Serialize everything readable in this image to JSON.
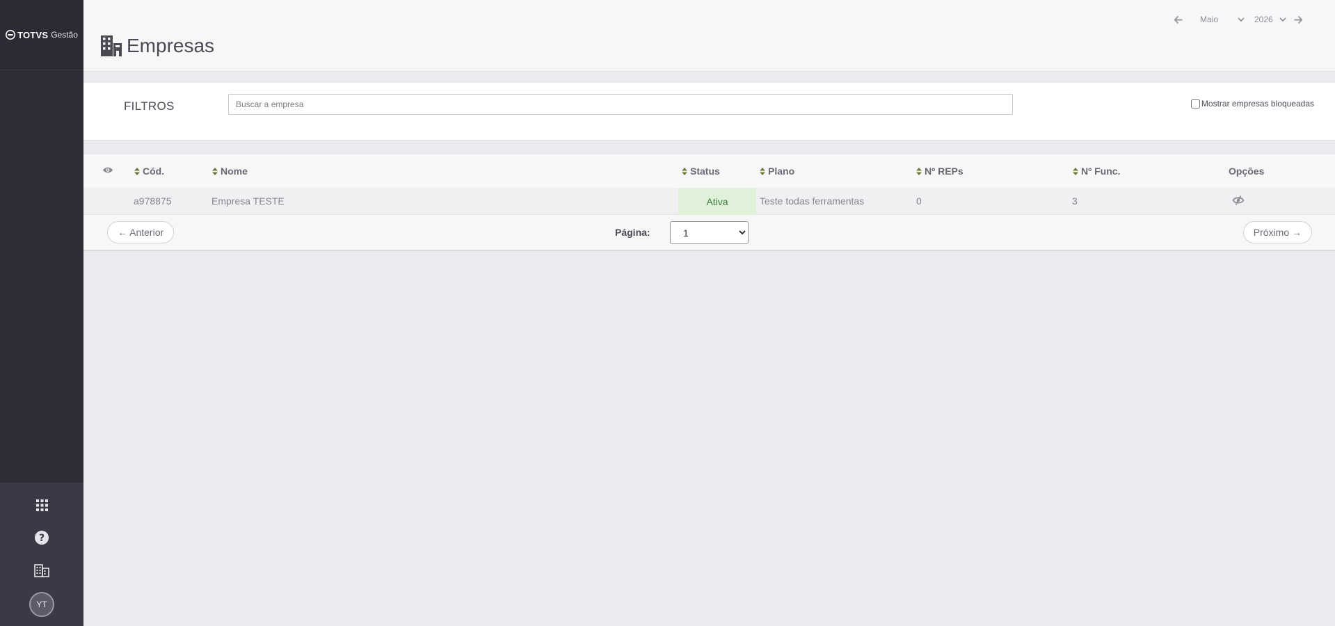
{
  "brand": {
    "logo_text": "TOTVS",
    "product": "Gestão"
  },
  "header": {
    "title": "Empresas",
    "month": "Maio",
    "year": "2026"
  },
  "filters": {
    "label": "FILTROS",
    "search_placeholder": "Buscar a empresa",
    "search_value": "",
    "show_blocked_label": "Mostrar empresas bloqueadas",
    "show_blocked_checked": false
  },
  "table": {
    "columns": {
      "code": "Cód.",
      "name": "Nome",
      "status": "Status",
      "plan": "Plano",
      "reps": "Nº REPs",
      "employees": "Nº Func.",
      "options": "Opções"
    },
    "rows": [
      {
        "code": "a978875",
        "name": "Empresa TESTE",
        "status": "Ativa",
        "plan": "Teste todas ferramentas",
        "reps": "0",
        "employees": "3"
      }
    ]
  },
  "pager": {
    "prev_label": "← Anterior",
    "next_label": "Próximo →",
    "page_label": "Página:",
    "current_page": "1"
  },
  "user": {
    "initials": "YT"
  },
  "colors": {
    "sidebar": "#2d2d38",
    "sidebar_bottom": "#3a3a47",
    "status_active_bg": "#dff1d8",
    "status_active_text": "#3b7a3b",
    "sort_arrow": "#6b7a3e"
  },
  "icons": {
    "visibility_column": "eye-icon",
    "option_row": "eye-slash-icon",
    "sidebar": [
      "apps-grid-icon",
      "help-icon",
      "building-icon"
    ],
    "title": "buildings-icon"
  }
}
